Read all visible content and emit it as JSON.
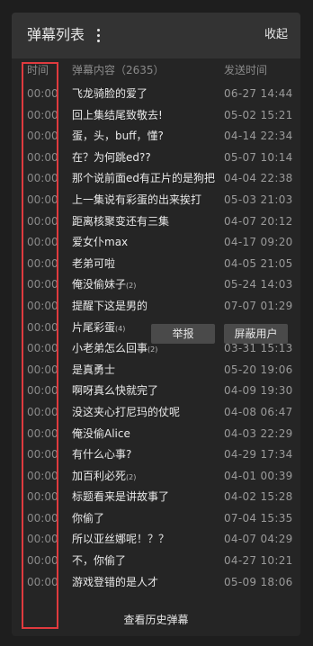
{
  "header": {
    "title": "弹幕列表",
    "collapse_label": "收起"
  },
  "columns": {
    "time": "时间",
    "content": "弹幕内容（2635）",
    "sent": "发送时间"
  },
  "rows": [
    {
      "time": "00:00",
      "content": "飞龙骑脸的爱了",
      "sent": "06-27 14:44"
    },
    {
      "time": "00:00",
      "content": "回上集结尾致敬去!",
      "sent": "05-02 15:21"
    },
    {
      "time": "00:00",
      "content": "蛋，头，buff，懂?",
      "sent": "04-14 22:34"
    },
    {
      "time": "00:00",
      "content": "在？为何跳ed??",
      "sent": "05-07 10:14"
    },
    {
      "time": "00:00",
      "content": "那个说前面ed有正片的是狗把",
      "sent": "04-04 22:38"
    },
    {
      "time": "00:00",
      "content": "上一集说有彩蛋的出来挨打",
      "sent": "05-03 21:03"
    },
    {
      "time": "00:00",
      "content": "距离核聚变还有三集",
      "sent": "04-07 20:12"
    },
    {
      "time": "00:00",
      "content": "爱女仆max",
      "sent": "04-17 09:20"
    },
    {
      "time": "00:00",
      "content": "老弟可啦",
      "sent": "04-05 21:05"
    },
    {
      "time": "00:00",
      "content": "俺没偷妹子",
      "sub": "(2)",
      "sent": "05-24 14:03"
    },
    {
      "time": "00:00",
      "content": "提醒下这是男的",
      "sent": "07-07 01:29"
    },
    {
      "time": "00:00",
      "content": "片尾彩蛋",
      "sub": "(4)",
      "sent": ""
    },
    {
      "time": "00:00",
      "content": "小老弟怎么回事",
      "sub": "(2)",
      "sent": "03-31 15:13"
    },
    {
      "time": "00:00",
      "content": "是真勇士",
      "sent": "05-20 19:06"
    },
    {
      "time": "00:00",
      "content": "啊呀真么快就完了",
      "sent": "04-09 19:30"
    },
    {
      "time": "00:00",
      "content": "没这夹心打尼玛的仗呢",
      "sent": "04-08 06:47"
    },
    {
      "time": "00:00",
      "content": "俺没偷Alice",
      "sent": "04-03 22:29"
    },
    {
      "time": "00:00",
      "content": "有什么心事?",
      "sent": "04-29 17:34"
    },
    {
      "time": "00:00",
      "content": "加百利必死",
      "sub": "(2)",
      "sent": "04-01 00:39"
    },
    {
      "time": "00:00",
      "content": "标题看来是讲故事了",
      "sent": "04-02 15:28"
    },
    {
      "time": "00:00",
      "content": "你偷了",
      "sent": "07-04 15:35"
    },
    {
      "time": "00:00",
      "content": "所以亚丝娜呢！？？",
      "sent": "04-07 04:29"
    },
    {
      "time": "00:00",
      "content": "不，你偷了",
      "sent": "04-27 10:21"
    },
    {
      "time": "00:00",
      "content": "游戏登错的是人才",
      "sent": "05-09 18:06"
    }
  ],
  "actions": {
    "report": "举报",
    "block": "屏蔽用户"
  },
  "footer": {
    "history_label": "查看历史弹幕"
  }
}
